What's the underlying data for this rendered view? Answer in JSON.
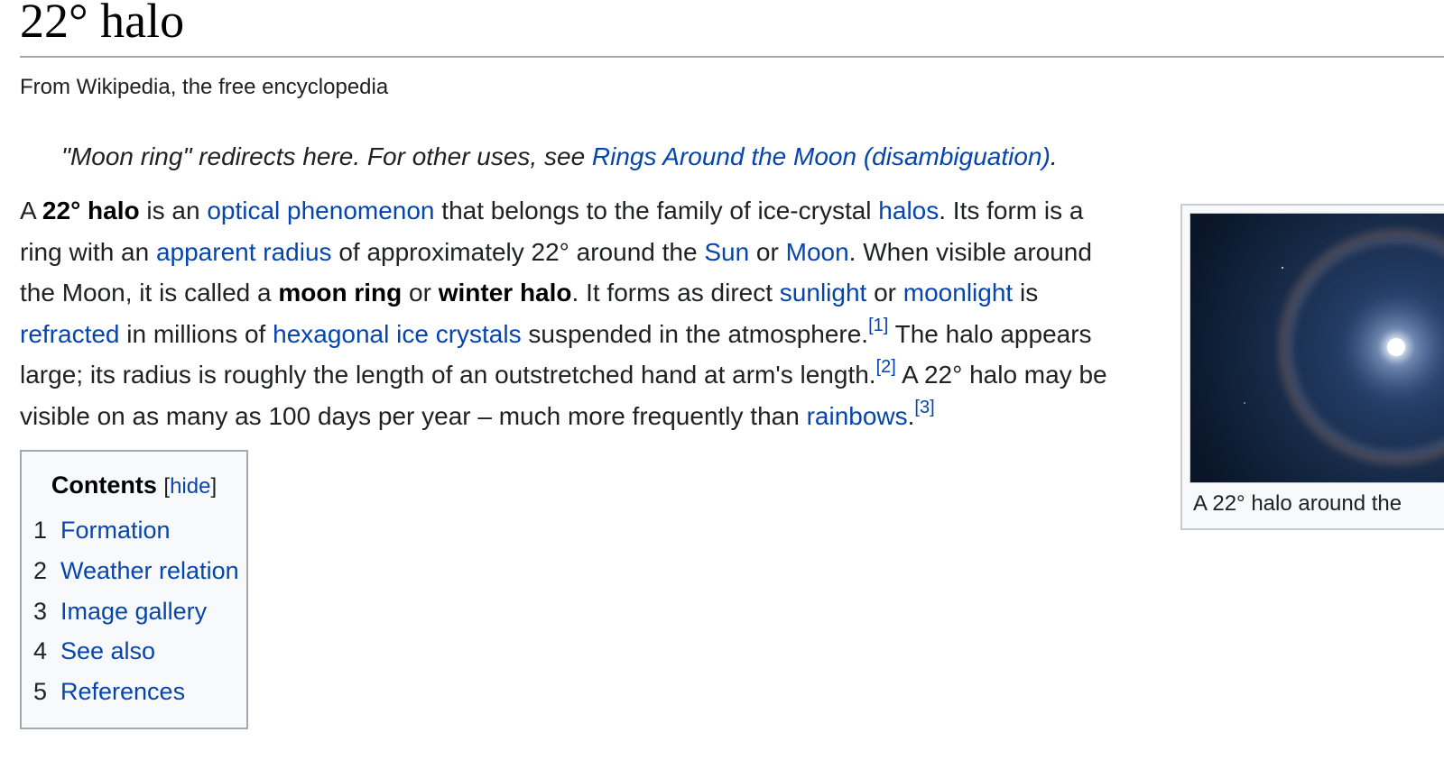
{
  "header": {
    "title": "22° halo",
    "tagline": "From Wikipedia, the free encyclopedia"
  },
  "hatnote": {
    "text": "\"Moon ring\" redirects here. For other uses, see ",
    "link": "Rings Around the Moon (disambiguation)",
    "end": "."
  },
  "lead": {
    "l1": {
      "t0": "A ",
      "b1": "22° halo",
      "t2": " is an ",
      "a3": "optical phenomenon",
      "t4": " that belongs to the family of ice-crystal ",
      "a5": "halos",
      "t6": ". Its form is a"
    },
    "l2": {
      "t0": "ring with an ",
      "a1": "apparent radius",
      "t2": " of approximately 22° around the ",
      "a3": "Sun",
      "t4": " or ",
      "a5": "Moon",
      "t6": ". When visible around"
    },
    "l3": {
      "t0": "the Moon, it is called a ",
      "b1": "moon ring",
      "t2": " or ",
      "b3": "winter halo",
      "t4": ". It forms as direct ",
      "a5": "sunlight",
      "t6": " or ",
      "a7": "moonlight",
      "t8": " is"
    },
    "l4": {
      "a0": "refracted",
      "t1": " in millions of ",
      "a2": "hexagonal ice crystals",
      "t3": " suspended in the atmosphere.",
      "r4": "[1]",
      "t5": " The halo appears"
    },
    "l5": {
      "t0": "large; its radius is roughly the length of an outstretched hand at arm's length.",
      "r1": "[2]",
      "t2": " A 22° halo may be"
    },
    "l6": {
      "t0": "visible on as many as 100 days per year – much more frequently than ",
      "a1": "rainbows",
      "t2": ".",
      "r3": "[3]"
    }
  },
  "toc": {
    "heading": "Contents",
    "bracket_open": "[",
    "toggle": "hide",
    "bracket_close": "]",
    "items": [
      {
        "num": "1",
        "label": "Formation"
      },
      {
        "num": "2",
        "label": "Weather relation"
      },
      {
        "num": "3",
        "label": "Image gallery"
      },
      {
        "num": "4",
        "label": "See also"
      },
      {
        "num": "5",
        "label": "References"
      }
    ]
  },
  "thumb": {
    "caption": "A 22° halo around the"
  },
  "colors": {
    "link": "#0645ad",
    "text": "#202122",
    "border": "#a2a9b1",
    "panel": "#f8f9fa"
  }
}
